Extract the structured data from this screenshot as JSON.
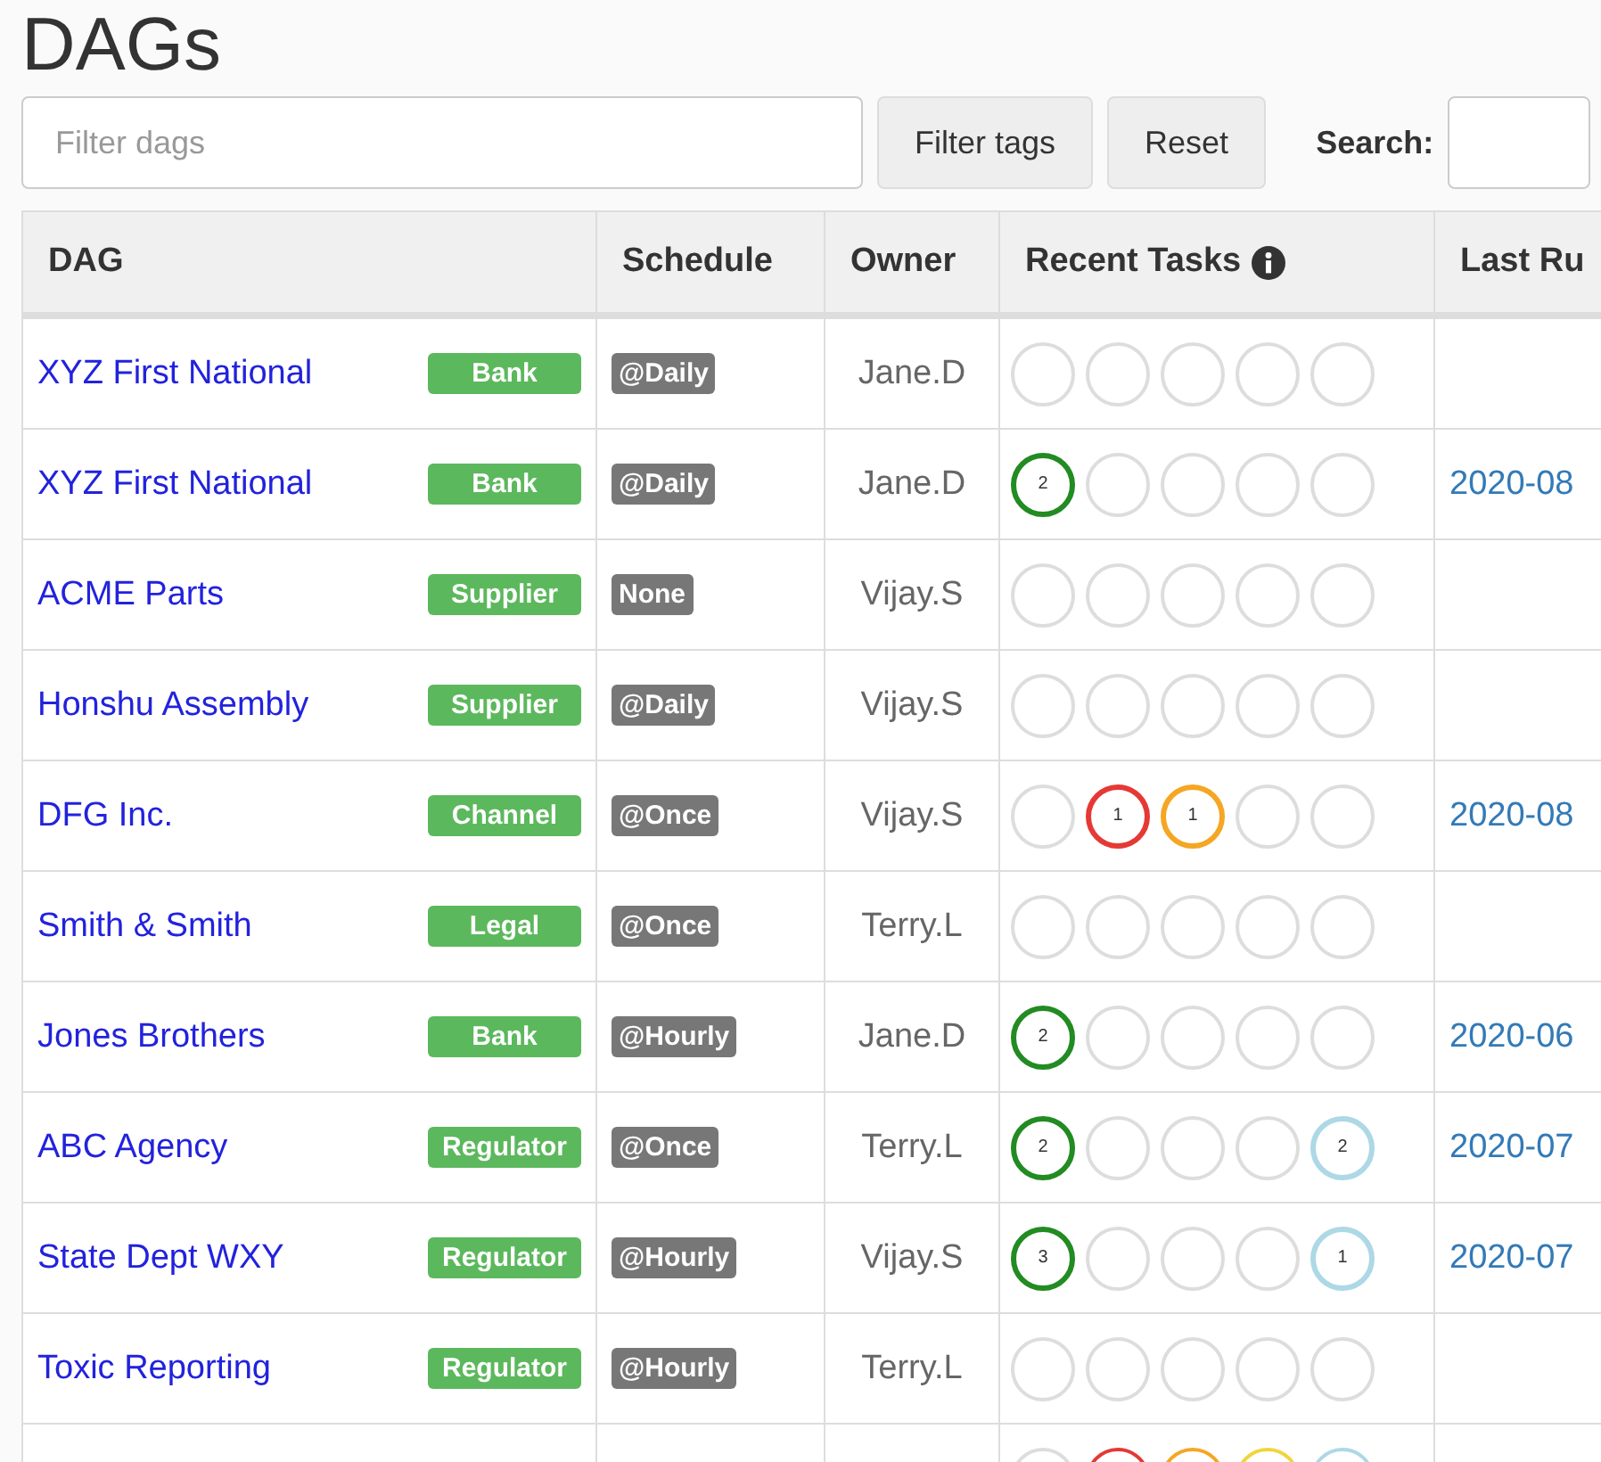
{
  "title": "DAGs",
  "filter": {
    "placeholder": "Filter dags"
  },
  "buttons": [
    "Filter tags",
    "Reset"
  ],
  "search": {
    "label": "Search:"
  },
  "table": {
    "columns": [
      "DAG",
      "Schedule",
      "Owner",
      "Recent Tasks",
      "Last Ru"
    ],
    "rows": [
      {
        "dag": "XYZ First National",
        "tag": "Bank",
        "schedule": "@Daily",
        "owner": "Jane.D",
        "tasks": [
          {
            "color": "#dddddd"
          },
          {
            "color": "#dddddd"
          },
          {
            "color": "#dddddd"
          },
          {
            "color": "#dddddd"
          },
          {
            "color": "#dddddd"
          }
        ]
      },
      {
        "dag": "XYZ First National",
        "tag": "Bank",
        "schedule": "@Daily",
        "owner": "Jane.D",
        "tasks": [
          {
            "color": "#228b22",
            "count": "2"
          },
          {
            "color": "#dddddd"
          },
          {
            "color": "#dddddd"
          },
          {
            "color": "#dddddd"
          },
          {
            "color": "#dddddd"
          }
        ],
        "last_run": "2020-08"
      },
      {
        "dag": "ACME Parts",
        "tag": "Supplier",
        "schedule": "None",
        "owner": "Vijay.S",
        "tasks": [
          {
            "color": "#dddddd"
          },
          {
            "color": "#dddddd"
          },
          {
            "color": "#dddddd"
          },
          {
            "color": "#dddddd"
          },
          {
            "color": "#dddddd"
          }
        ]
      },
      {
        "dag": "Honshu Assembly",
        "tag": "Supplier",
        "schedule": "@Daily",
        "owner": "Vijay.S",
        "tasks": [
          {
            "color": "#dddddd"
          },
          {
            "color": "#dddddd"
          },
          {
            "color": "#dddddd"
          },
          {
            "color": "#dddddd"
          },
          {
            "color": "#dddddd"
          }
        ]
      },
      {
        "dag": "DFG Inc.",
        "tag": "Channel",
        "schedule": "@Once",
        "owner": "Vijay.S",
        "tasks": [
          {
            "color": "#dddddd"
          },
          {
            "color": "#e53935",
            "count": "1"
          },
          {
            "color": "#f5a623",
            "count": "1"
          },
          {
            "color": "#dddddd"
          },
          {
            "color": "#dddddd"
          }
        ],
        "last_run": "2020-08"
      },
      {
        "dag": "Smith & Smith",
        "tag": "Legal",
        "schedule": "@Once",
        "owner": "Terry.L",
        "tasks": [
          {
            "color": "#dddddd"
          },
          {
            "color": "#dddddd"
          },
          {
            "color": "#dddddd"
          },
          {
            "color": "#dddddd"
          },
          {
            "color": "#dddddd"
          }
        ]
      },
      {
        "dag": "Jones Brothers",
        "tag": "Bank",
        "schedule": "@Hourly",
        "owner": "Jane.D",
        "tasks": [
          {
            "color": "#228b22",
            "count": "2"
          },
          {
            "color": "#dddddd"
          },
          {
            "color": "#dddddd"
          },
          {
            "color": "#dddddd"
          },
          {
            "color": "#dddddd"
          }
        ],
        "last_run": "2020-06"
      },
      {
        "dag": "ABC Agency",
        "tag": "Regulator",
        "schedule": "@Once",
        "owner": "Terry.L",
        "tasks": [
          {
            "color": "#228b22",
            "count": "2"
          },
          {
            "color": "#dddddd"
          },
          {
            "color": "#dddddd"
          },
          {
            "color": "#dddddd"
          },
          {
            "color": "#add8e6",
            "count": "2"
          }
        ],
        "last_run": "2020-07"
      },
      {
        "dag": "State Dept WXY",
        "tag": "Regulator",
        "schedule": "@Hourly",
        "owner": "Vijay.S",
        "tasks": [
          {
            "color": "#228b22",
            "count": "3"
          },
          {
            "color": "#dddddd"
          },
          {
            "color": "#dddddd"
          },
          {
            "color": "#dddddd"
          },
          {
            "color": "#add8e6",
            "count": "1"
          }
        ],
        "last_run": "2020-07"
      },
      {
        "dag": "Toxic Reporting",
        "tag": "Regulator",
        "schedule": "@Hourly",
        "owner": "Terry.L",
        "tasks": [
          {
            "color": "#dddddd"
          },
          {
            "color": "#dddddd"
          },
          {
            "color": "#dddddd"
          },
          {
            "color": "#dddddd"
          },
          {
            "color": "#dddddd"
          }
        ]
      },
      {
        "tasks": [
          {
            "color": "#dddddd"
          },
          {
            "color": "#e53935"
          },
          {
            "color": "#f5a623"
          },
          {
            "color": "#f2d43c"
          },
          {
            "color": "#add8e6"
          }
        ]
      }
    ]
  }
}
